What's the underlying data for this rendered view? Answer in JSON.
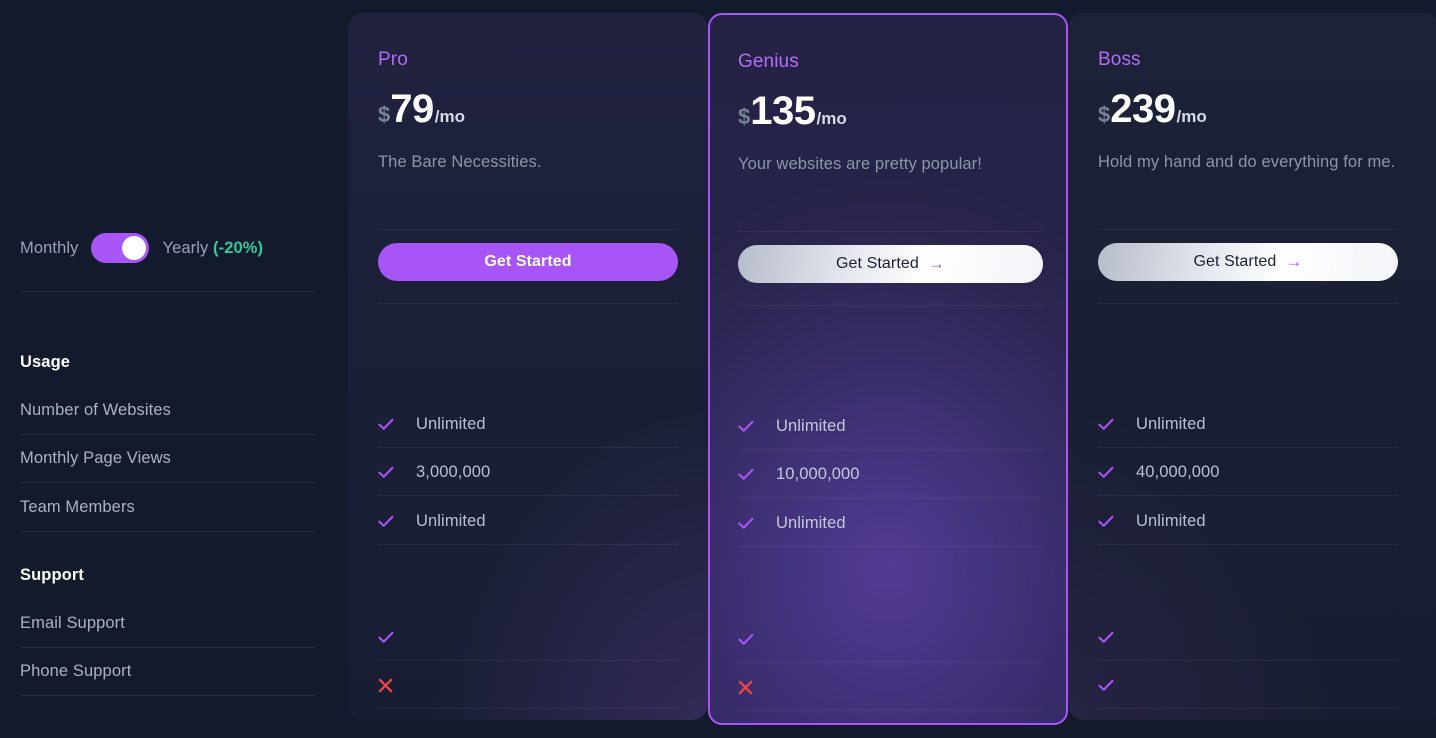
{
  "theme": {
    "background": "#131a2b",
    "accent": "#a855f7",
    "plan_name_color": "#b26bf7",
    "discount_color": "#2ecb9b",
    "cross_color": "#ef4444",
    "check_color": "#a855f7"
  },
  "sidebar": {
    "billing": {
      "monthly_label": "Monthly",
      "yearly_label": "Yearly",
      "discount_label": "(-20%)",
      "toggle_state": "yearly"
    },
    "groups": [
      {
        "title": "Usage",
        "rows": [
          "Number of Websites",
          "Monthly Page Views",
          "Team Members"
        ]
      },
      {
        "title": "Support",
        "rows": [
          "Email Support",
          "Phone Support"
        ]
      }
    ]
  },
  "plans": [
    {
      "name": "Pro",
      "currency": "$",
      "amount": "79",
      "period": "/mo",
      "tagline": "The Bare Necessities.",
      "cta_label": "Get Started",
      "cta_style": "primary",
      "cta_arrow": "",
      "highlighted": false,
      "features": [
        {
          "type": "check",
          "value": "Unlimited"
        },
        {
          "type": "check",
          "value": "3,000,000"
        },
        {
          "type": "check",
          "value": "Unlimited"
        }
      ],
      "support": [
        {
          "type": "check",
          "value": ""
        },
        {
          "type": "cross",
          "value": ""
        }
      ]
    },
    {
      "name": "Genius",
      "currency": "$",
      "amount": "135",
      "period": "/mo",
      "tagline": "Your websites are pretty popular!",
      "cta_label": "Get Started",
      "cta_style": "light",
      "cta_arrow": "→",
      "highlighted": true,
      "features": [
        {
          "type": "check",
          "value": "Unlimited"
        },
        {
          "type": "check",
          "value": "10,000,000"
        },
        {
          "type": "check",
          "value": "Unlimited"
        }
      ],
      "support": [
        {
          "type": "check",
          "value": ""
        },
        {
          "type": "cross",
          "value": ""
        }
      ]
    },
    {
      "name": "Boss",
      "currency": "$",
      "amount": "239",
      "period": "/mo",
      "tagline": "Hold my hand and do everything for me.",
      "cta_label": "Get Started",
      "cta_style": "light",
      "cta_arrow": "→",
      "highlighted": false,
      "features": [
        {
          "type": "check",
          "value": "Unlimited"
        },
        {
          "type": "check",
          "value": "40,000,000"
        },
        {
          "type": "check",
          "value": "Unlimited"
        }
      ],
      "support": [
        {
          "type": "check",
          "value": ""
        },
        {
          "type": "check",
          "value": ""
        }
      ]
    }
  ]
}
